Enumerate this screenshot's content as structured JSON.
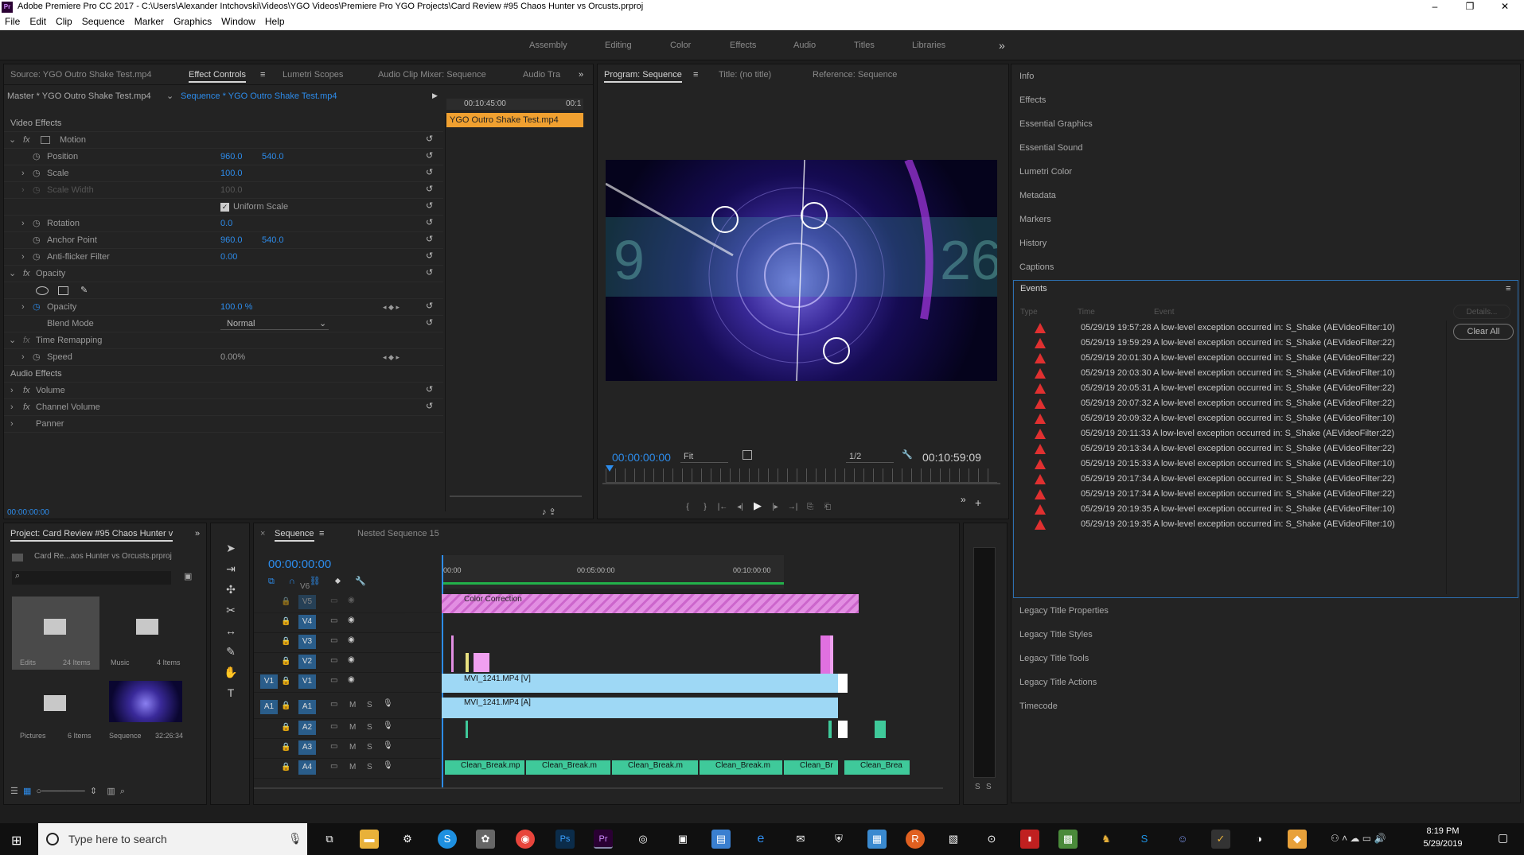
{
  "window": {
    "title": "Adobe Premiere Pro CC 2017 - C:\\Users\\Alexander Intchovski\\Videos\\YGO Videos\\Premiere Pro YGO Projects\\Card Review #95 Chaos Hunter vs Orcusts.prproj",
    "minimize": "–",
    "maximize": "❐",
    "close": "✕"
  },
  "menu": [
    "File",
    "Edit",
    "Clip",
    "Sequence",
    "Marker",
    "Graphics",
    "Window",
    "Help"
  ],
  "workspaces": [
    "Assembly",
    "Editing",
    "Color",
    "Effects",
    "Audio",
    "Titles",
    "Libraries"
  ],
  "workspace_more": "»",
  "source_panel": {
    "tabs": [
      "Source: YGO Outro Shake Test.mp4",
      "Effect Controls",
      "Lumetri Scopes",
      "Audio Clip Mixer: Sequence",
      "Audio Tra"
    ],
    "more": "»",
    "master": "Master * YGO Outro Shake Test.mp4",
    "sequence": "Sequence * YGO Outro Shake Test.mp4",
    "mini_timecode1": "00:10:45:00",
    "mini_timecode2": "00:1",
    "mini_clip": "YGO Outro Shake Test.mp4",
    "video_effects": "Video Effects",
    "rows": [
      {
        "label": "Motion",
        "v1": "",
        "v2": ""
      },
      {
        "label": "Position",
        "v1": "960.0",
        "v2": "540.0"
      },
      {
        "label": "Scale",
        "v1": "100.0",
        "v2": ""
      },
      {
        "label": "Scale Width",
        "v1": "100.0",
        "v2": ""
      },
      {
        "label": "Uniform Scale",
        "v1": "",
        "v2": ""
      },
      {
        "label": "Rotation",
        "v1": "0.0",
        "v2": ""
      },
      {
        "label": "Anchor Point",
        "v1": "960.0",
        "v2": "540.0"
      },
      {
        "label": "Anti-flicker Filter",
        "v1": "0.00",
        "v2": ""
      },
      {
        "label": "Opacity",
        "v1": "",
        "v2": ""
      },
      {
        "label": "",
        "v1": "",
        "v2": ""
      },
      {
        "label": "Opacity",
        "v1": "100.0 %",
        "v2": ""
      },
      {
        "label": "Blend Mode",
        "v1": "Normal",
        "v2": ""
      },
      {
        "label": "Time Remapping",
        "v1": "",
        "v2": ""
      },
      {
        "label": "Speed",
        "v1": "0.00%",
        "v2": ""
      }
    ],
    "audio_effects": "Audio Effects",
    "audio_rows": [
      "Volume",
      "Channel Volume",
      "Panner"
    ],
    "timecode": "00:00:00:00"
  },
  "program_panel": {
    "tabs": [
      "Program: Sequence",
      "Title: (no title)",
      "Reference: Sequence"
    ],
    "timecode": "00:00:00:00",
    "fit": "Fit",
    "res": "1/2",
    "duration": "00:10:59:09",
    "controls": [
      "{",
      "}",
      "|←",
      "◂|",
      "▶",
      "|▸",
      "→|",
      "⎘",
      "⎗"
    ],
    "more": "»",
    "add": "+"
  },
  "right_panel": {
    "items_top": [
      "Info",
      "Effects",
      "Essential Graphics",
      "Essential Sound",
      "Lumetri Color",
      "Metadata",
      "Markers",
      "History",
      "Captions"
    ],
    "events_title": "Events",
    "events_cols": [
      "Type",
      "Time",
      "Event"
    ],
    "details": "Details...",
    "clear_all": "Clear All",
    "events": [
      {
        "time": "05/29/19 19:57:28",
        "msg": "A low-level exception occurred in: S_Shake (AEVideoFilter:10)"
      },
      {
        "time": "05/29/19 19:59:29",
        "msg": "A low-level exception occurred in: S_Shake (AEVideoFilter:22)"
      },
      {
        "time": "05/29/19 20:01:30",
        "msg": "A low-level exception occurred in: S_Shake (AEVideoFilter:22)"
      },
      {
        "time": "05/29/19 20:03:30",
        "msg": "A low-level exception occurred in: S_Shake (AEVideoFilter:10)"
      },
      {
        "time": "05/29/19 20:05:31",
        "msg": "A low-level exception occurred in: S_Shake (AEVideoFilter:22)"
      },
      {
        "time": "05/29/19 20:07:32",
        "msg": "A low-level exception occurred in: S_Shake (AEVideoFilter:22)"
      },
      {
        "time": "05/29/19 20:09:32",
        "msg": "A low-level exception occurred in: S_Shake (AEVideoFilter:10)"
      },
      {
        "time": "05/29/19 20:11:33",
        "msg": "A low-level exception occurred in: S_Shake (AEVideoFilter:22)"
      },
      {
        "time": "05/29/19 20:13:34",
        "msg": "A low-level exception occurred in: S_Shake (AEVideoFilter:22)"
      },
      {
        "time": "05/29/19 20:15:33",
        "msg": "A low-level exception occurred in: S_Shake (AEVideoFilter:10)"
      },
      {
        "time": "05/29/19 20:17:34",
        "msg": "A low-level exception occurred in: S_Shake (AEVideoFilter:22)"
      },
      {
        "time": "05/29/19 20:17:34",
        "msg": "A low-level exception occurred in: S_Shake (AEVideoFilter:22)"
      },
      {
        "time": "05/29/19 20:19:35",
        "msg": "A low-level exception occurred in: S_Shake (AEVideoFilter:10)"
      },
      {
        "time": "05/29/19 20:19:35",
        "msg": "A low-level exception occurred in: S_Shake (AEVideoFilter:10)"
      }
    ],
    "items_bottom": [
      "Legacy Title Properties",
      "Legacy Title Styles",
      "Legacy Title Tools",
      "Legacy Title Actions",
      "Timecode"
    ],
    "events_menu": "≡"
  },
  "project_panel": {
    "tab": "Project: Card Review #95 Chaos Hunter v",
    "more": "»",
    "file": "Card Re...aos Hunter vs Orcusts.prproj",
    "bins": [
      {
        "name": "Edits",
        "count": "24 Items"
      },
      {
        "name": "Music",
        "count": "4 Items"
      },
      {
        "name": "Pictures",
        "count": "6 Items"
      },
      {
        "name": "Sequence",
        "count": "32:26:34"
      }
    ]
  },
  "timeline": {
    "tabs": [
      "Sequence",
      "Nested Sequence 15"
    ],
    "timecode": "00:00:00:00",
    "ruler": [
      "00:00",
      "00:05:00:00",
      "00:10:00:00"
    ],
    "tracks_v": [
      "V6",
      "V5",
      "V4",
      "V3",
      "V2",
      "V1"
    ],
    "tracks_a": [
      "A1",
      "A2",
      "A3",
      "A4"
    ],
    "src_v": "V1",
    "src_a": "A1",
    "m": "M",
    "s": "S",
    "clips": {
      "color_correction": "Color Correction",
      "v1": "MVI_1241.MP4 [V]",
      "a1": "MVI_1241.MP4 [A]",
      "a4": [
        "Clean_Break.mp",
        "Clean_Break.m",
        "Clean_Break.m",
        "Clean_Break.m",
        "Clean_Br",
        "Clean_Brea"
      ]
    },
    "meter_labels": [
      "S",
      "S"
    ]
  },
  "taskbar": {
    "search_placeholder": "Type here to search",
    "time": "8:19 PM",
    "date": "5/29/2019"
  },
  "colors": {
    "accent": "#2d8ceb",
    "clip_blue": "#9ed8f5",
    "clip_pink": "#e89ee8",
    "clip_green": "#3fc99a",
    "warn": "#e03030"
  }
}
